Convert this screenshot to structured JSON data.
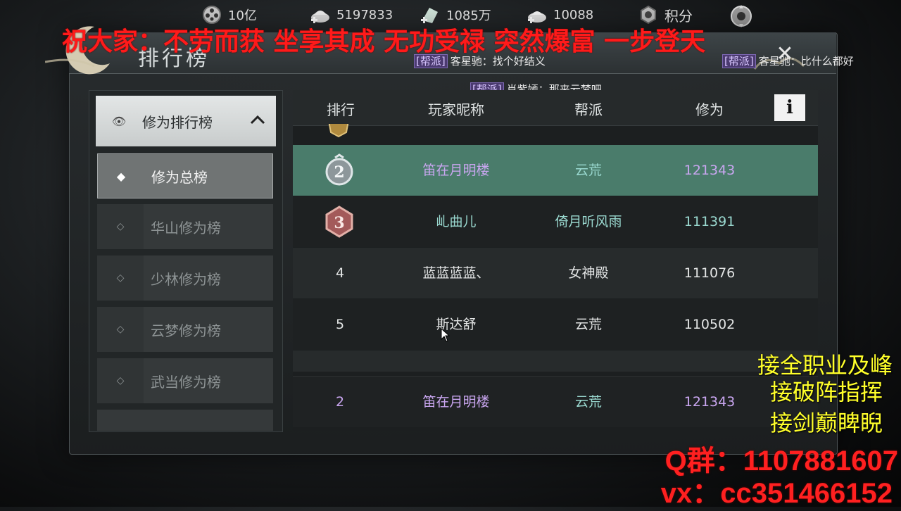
{
  "currency": [
    {
      "icon": "film-reel-icon",
      "value": "10亿"
    },
    {
      "icon": "silver-ingot-plus-icon",
      "value": "5197833"
    },
    {
      "icon": "jade-plus-icon",
      "value": "1085万"
    },
    {
      "icon": "ingot-plus-icon",
      "value": "10088"
    },
    {
      "icon": "points-icon",
      "value": "积分"
    }
  ],
  "banner": "祝大家：不劳而获 坐享其成 无功受禄 突然爆富 一步登天",
  "panel": {
    "title": "排行榜"
  },
  "chat": [
    {
      "tag": "[帮派]",
      "text": "客星驰：找个好结义"
    },
    {
      "tag": "[帮派]",
      "text": "客星驰：比什么都好"
    },
    {
      "tag": "[帮派]",
      "text": "肖紫嫣：那来云梦吧"
    }
  ],
  "menu": {
    "category": "修为排行榜",
    "items": [
      {
        "label": "修为总榜",
        "active": true
      },
      {
        "label": "华山修为榜",
        "active": false
      },
      {
        "label": "少林修为榜",
        "active": false
      },
      {
        "label": "云梦修为榜",
        "active": false
      },
      {
        "label": "武当修为榜",
        "active": false
      }
    ]
  },
  "table": {
    "headers": [
      "排行",
      "玩家昵称",
      "帮派",
      "修为"
    ],
    "info_label": "i",
    "rows": [
      {
        "rank": "2",
        "name": "笛在月明楼",
        "guild": "云荒",
        "score": "121343"
      },
      {
        "rank": "3",
        "name": "乢曲儿",
        "guild": "倚月听风雨",
        "score": "111391"
      },
      {
        "rank": "4",
        "name": "蓝蓝蓝蓝、",
        "guild": "女神殿",
        "score": "111076"
      },
      {
        "rank": "5",
        "name": "斯达舒",
        "guild": "云荒",
        "score": "110502"
      }
    ],
    "self_row": {
      "rank": "2",
      "name": "笛在月明楼",
      "guild": "云荒",
      "score": "121343"
    }
  },
  "overlay": {
    "ads": [
      "接全职业及峰",
      "接破阵指挥",
      "接剑巅睥睨"
    ],
    "qq": "Q群：1107881607",
    "vx": "vx：cc351466152"
  }
}
